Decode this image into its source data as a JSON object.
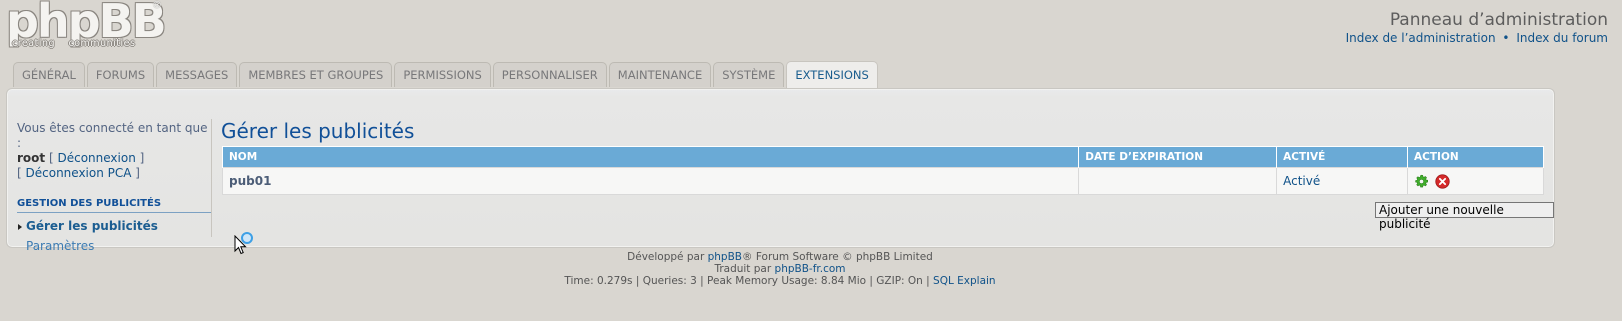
{
  "header": {
    "logo_text": "phpBB",
    "logo_reg": "®",
    "logo_tagline": "creating communities",
    "admin_title": "Panneau d’administration",
    "link_acp_index": "Index de l’administration",
    "link_sep": "•",
    "link_forum_index": "Index du forum"
  },
  "tabs": [
    {
      "label": "Général"
    },
    {
      "label": "Forums"
    },
    {
      "label": "Messages"
    },
    {
      "label": "Membres et groupes"
    },
    {
      "label": "Permissions"
    },
    {
      "label": "Personnaliser"
    },
    {
      "label": "Maintenance"
    },
    {
      "label": "Système"
    },
    {
      "label": "Extensions",
      "active": true
    }
  ],
  "sidebar": {
    "connected_as": "Vous êtes connecté en tant que :",
    "username": "root",
    "logout": "Déconnexion",
    "logout_acp": "Déconnexion PCA",
    "section_heading": "Gestion des publicités",
    "items": [
      {
        "label": "Gérer les publicités",
        "active": true
      },
      {
        "label": "Paramètres"
      }
    ]
  },
  "main": {
    "title": "Gérer les publicités",
    "columns": [
      "Nom",
      "Date d’expiration",
      "Activé",
      "Action"
    ],
    "rows": [
      {
        "name": "pub01",
        "expiration": "",
        "enabled": "Activé",
        "actions": [
          "settings-icon",
          "delete-icon"
        ]
      }
    ],
    "add_button": "Ajouter une nouvelle publicité"
  },
  "footer": {
    "developed_prefix": "Développé par ",
    "phpbb_link": "phpBB",
    "developed_suffix": "® Forum Software © phpBB Limited",
    "translated_prefix": "Traduit par ",
    "translated_link": "phpBB-fr.com",
    "stats": "Time: 0.279s | Queries: 3 | Peak Memory Usage: 8.84 Mio | GZIP: On | ",
    "sql_explain": "SQL Explain"
  },
  "colors": {
    "background": "#d9d6d0",
    "table_header": "#6aaad6",
    "link": "#105289",
    "title": "#115098"
  }
}
